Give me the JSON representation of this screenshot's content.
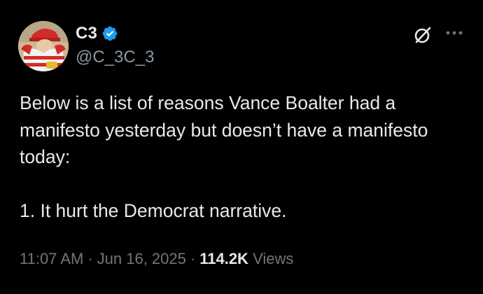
{
  "author": {
    "display_name": "C3",
    "handle": "@C_3C_3",
    "verified": true,
    "verified_badge_color": "#1d9bf0",
    "avatar_icon": "avatar-image"
  },
  "header_actions": {
    "grok_icon": "grok-icon",
    "more_icon": "more-icon"
  },
  "tweet": {
    "paragraph_1": "Below is a list of reasons Vance Boalter had a manifesto yesterday but doesn’t have a manifesto today:",
    "paragraph_2": "1. It hurt the Democrat narrative."
  },
  "meta": {
    "time": "11:07 AM",
    "separator": "·",
    "date": "Jun 16, 2025",
    "views_count": "114.2K",
    "views_label": "Views"
  },
  "colors": {
    "background": "#000000",
    "primary_text": "#e7e9ea",
    "secondary_text": "#71767b",
    "accent": "#1d9bf0"
  }
}
